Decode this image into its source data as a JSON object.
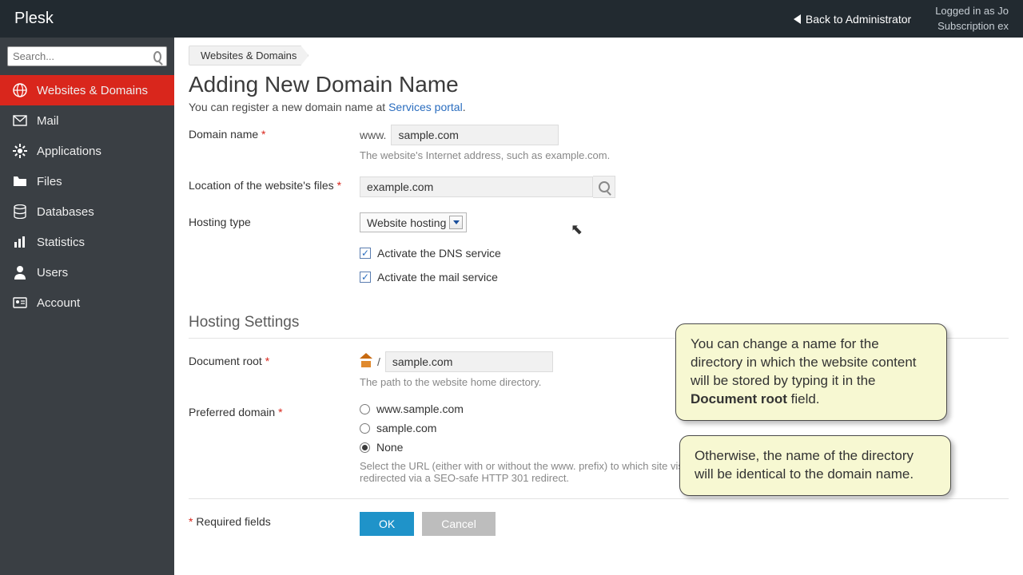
{
  "topbar": {
    "brand": "Plesk",
    "back": "Back to Administrator",
    "logged_in_prefix": "Logged in as",
    "logged_in_user": "Jo",
    "subscription_prefix": "Subscription",
    "subscription_value": "ex"
  },
  "search": {
    "placeholder": "Search..."
  },
  "nav": {
    "websites": "Websites & Domains",
    "mail": "Mail",
    "applications": "Applications",
    "files": "Files",
    "databases": "Databases",
    "statistics": "Statistics",
    "users": "Users",
    "account": "Account"
  },
  "crumb": {
    "websites": "Websites & Domains"
  },
  "page": {
    "title": "Adding New Domain Name",
    "intro_prefix": "You can register a new domain name at ",
    "intro_link": "Services portal",
    "intro_suffix": "."
  },
  "labels": {
    "domain_name": "Domain name",
    "location": "Location of the website's files",
    "hosting_type": "Hosting type",
    "document_root": "Document root",
    "preferred_domain": "Preferred domain",
    "required_fields": "Required fields"
  },
  "values": {
    "www_prefix": "www.",
    "domain_name": "sample.com",
    "domain_hint": "The website's Internet address, such as example.com.",
    "location": "example.com",
    "hosting_type": "Website hosting",
    "dns_checkbox": "Activate the DNS service",
    "mail_checkbox": "Activate the mail service",
    "section_hosting": "Hosting Settings",
    "slash": "/",
    "doc_root": "sample.com",
    "doc_root_hint": "The path to the website home directory.",
    "pref_www": "www.sample.com",
    "pref_bare": "sample.com",
    "pref_none": "None",
    "pref_hint": "Select the URL (either with or without the www. prefix) to which site visitors will be redirected via a SEO-safe HTTP 301 redirect."
  },
  "buttons": {
    "ok": "OK",
    "cancel": "Cancel"
  },
  "callouts": {
    "c1_pre": "You can change a name for the directory in which the website content will be stored by typing it in the ",
    "c1_bold": "Document root",
    "c1_post": " field.",
    "c2": "Otherwise, the name of the directory will be identical to the domain name."
  }
}
